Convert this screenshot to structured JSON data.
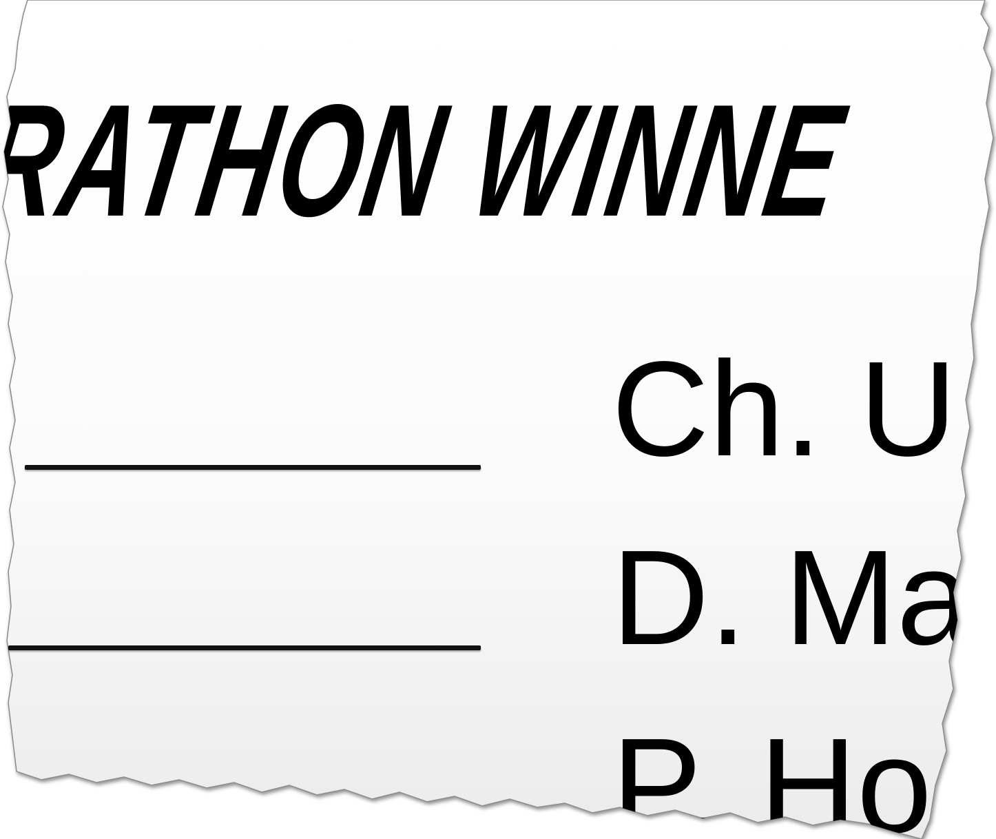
{
  "headline": "ARATHON WINNE",
  "answer_blanks": [
    {
      "label": ""
    },
    {
      "label": ""
    }
  ],
  "names": [
    "Ch. U",
    "D. Ma",
    "P. Ho"
  ],
  "colors": {
    "paper_top": "#ffffff",
    "paper_bottom": "#ececec",
    "ink": "#000000",
    "edge_shadow": "#9a9a9a"
  }
}
